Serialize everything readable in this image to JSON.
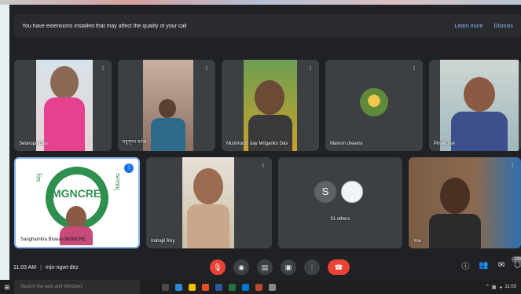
{
  "banner": {
    "message": "You have extensions installed that may affect the quality of your call",
    "learn_more": "Learn more",
    "dismiss": "Dismiss"
  },
  "participants": [
    {
      "name": "Setarupa Das",
      "icon": "mic-muted-icon"
    },
    {
      "name": "মধুসূদন মাঝি",
      "icon": "mic-muted-icon"
    },
    {
      "name": "Mushroom day Mriganko Das",
      "icon": "mic-muted-icon"
    },
    {
      "name": "Mamon dreams",
      "icon": "mic-muted-icon"
    },
    {
      "name": "Pinaki Pal",
      "icon": "mic-muted-icon"
    },
    {
      "name": "Sanghamitra Biswas MGNCRE",
      "icon": "pin-icon"
    },
    {
      "name": "Indrajit Roy",
      "icon": "mic-muted-icon"
    },
    {
      "name": "91 others",
      "avatar_letter": "S"
    },
    {
      "name": "You",
      "icon": "mic-muted-icon"
    }
  ],
  "logo": {
    "text_left": "বিশ্ব",
    "text_right": "অনন্তম্",
    "org": "MGNCRE"
  },
  "bottom_bar": {
    "time": "11:03 AM",
    "meeting_code": "mjo-ngwt-dez",
    "participant_count": "100"
  },
  "taskbar": {
    "search_placeholder": "Search the web and Windows",
    "clock": "11:03"
  },
  "colors": {
    "call_background": "#202124",
    "tile_background": "#3c4043",
    "end_call_red": "#ea4335",
    "link_blue": "#8ab4f8"
  }
}
